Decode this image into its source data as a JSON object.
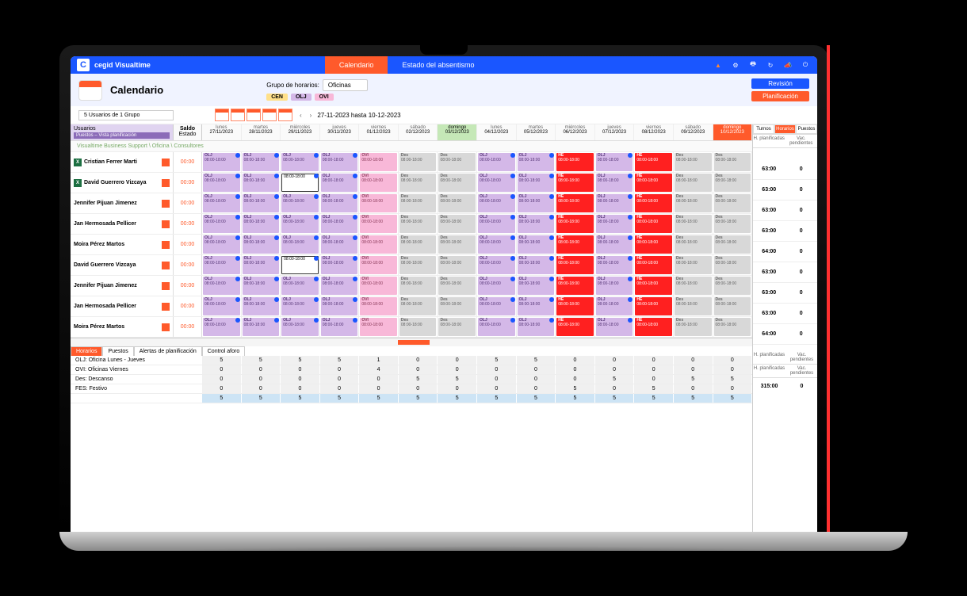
{
  "brand": "cegid Visualtime",
  "nav": {
    "calendario": "Calendario",
    "estado": "Estado del absentismo"
  },
  "page": {
    "title": "Calendario",
    "group_label": "Grupo de horarios:",
    "group_value": "Oficinas"
  },
  "pills": [
    {
      "label": "CEN",
      "bg": "#ffe08a"
    },
    {
      "label": "OLJ",
      "bg": "#d4b8e8"
    },
    {
      "label": "OVI",
      "bg": "#f8b8d8"
    }
  ],
  "buttons": {
    "revision": "Revisión",
    "planificacion": "Planificación"
  },
  "search": "5 Usuarios de 1 Grupo",
  "date_range": "27-11-2023 hasta 10-12-2023",
  "hdr": {
    "usuarios": "Usuarios",
    "usuarios_sub": "Puestos – Vista planificación",
    "saldo": "Saldo",
    "estado": "Estado"
  },
  "days": [
    {
      "dow": "lunes",
      "date": "27/11/2023"
    },
    {
      "dow": "martes",
      "date": "28/11/2023"
    },
    {
      "dow": "miércoles",
      "date": "29/11/2023"
    },
    {
      "dow": "jueves",
      "date": "30/11/2023"
    },
    {
      "dow": "viernes",
      "date": "01/12/2023"
    },
    {
      "dow": "sábado",
      "date": "02/12/2023"
    },
    {
      "dow": "domingo",
      "date": "03/12/2023",
      "active": true
    },
    {
      "dow": "lunes",
      "date": "04/12/2023"
    },
    {
      "dow": "martes",
      "date": "05/12/2023"
    },
    {
      "dow": "miércoles",
      "date": "06/12/2023"
    },
    {
      "dow": "jueves",
      "date": "07/12/2023"
    },
    {
      "dow": "viernes",
      "date": "08/12/2023"
    },
    {
      "dow": "sábado",
      "date": "09/12/2023"
    },
    {
      "dow": "domingo",
      "date": "10/12/2023",
      "last": true
    }
  ],
  "breadcrumb": "Visualtime Business Support \\ Oficina \\ Consultores",
  "employees": [
    {
      "name": "Cristian Ferrer Marti",
      "saldo": "00:00",
      "h": "63:00",
      "v": "0",
      "excel": true
    },
    {
      "name": "David Guerrero Vizcaya",
      "saldo": "00:00",
      "h": "63:00",
      "v": "0",
      "excel": true,
      "white29": true
    },
    {
      "name": "Jennifer Pijuan Jimenez",
      "saldo": "00:00",
      "h": "63:00",
      "v": "0"
    },
    {
      "name": "Jan Hermosada Pellicer",
      "saldo": "00:00",
      "h": "63:00",
      "v": "0"
    },
    {
      "name": "Moira Pérez Martos",
      "saldo": "00:00",
      "h": "64:00",
      "v": "0",
      "marker": true
    },
    {
      "name": "David Guerrero Vizcaya",
      "saldo": "00:00",
      "h": "63:00",
      "v": "0",
      "white29": true
    },
    {
      "name": "Jennifer Pijuan Jimenez",
      "saldo": "00:00",
      "h": "63:00",
      "v": "0"
    },
    {
      "name": "Jan Hermosada Pellicer",
      "saldo": "00:00",
      "h": "63:00",
      "v": "0"
    },
    {
      "name": "Moira Pérez Martos",
      "saldo": "00:00",
      "h": "64:00",
      "v": "0",
      "marker": true
    }
  ],
  "shift_labels": {
    "olj": "OLJ",
    "ovi": "OVI",
    "des": "Des",
    "fes": "FES",
    "h": "HE"
  },
  "shift_times": "08:00-18:00",
  "side": {
    "tabs": [
      "Turnos",
      "Horarios",
      "Puestos"
    ],
    "cols": [
      "H. planificadas",
      "Vac. pendientes"
    ]
  },
  "bottom": {
    "tabs": [
      "Horarios",
      "Puestos",
      "Alertas de planificación",
      "Control aforo"
    ],
    "rows": [
      {
        "label": "OLJ: Oficina Lunes - Jueves",
        "vals": [
          "5",
          "5",
          "5",
          "5",
          "1",
          "0",
          "0",
          "5",
          "5",
          "0",
          "0",
          "0",
          "0",
          "0"
        ]
      },
      {
        "label": "OVI: Oficinas Viernes",
        "vals": [
          "0",
          "0",
          "0",
          "0",
          "4",
          "0",
          "0",
          "0",
          "0",
          "0",
          "0",
          "0",
          "0",
          "0"
        ]
      },
      {
        "label": "Des: Descanso",
        "vals": [
          "0",
          "0",
          "0",
          "0",
          "0",
          "5",
          "5",
          "0",
          "0",
          "0",
          "5",
          "0",
          "5",
          "5"
        ]
      },
      {
        "label": "FES: Festivo",
        "vals": [
          "0",
          "0",
          "0",
          "0",
          "0",
          "0",
          "0",
          "0",
          "0",
          "5",
          "0",
          "5",
          "0",
          "0"
        ]
      }
    ],
    "total": [
      "5",
      "5",
      "5",
      "5",
      "5",
      "5",
      "5",
      "5",
      "5",
      "5",
      "5",
      "5",
      "5",
      "5"
    ],
    "side_cols": [
      "H. planificadas",
      "Vac. pendientes"
    ],
    "side_cols2": [
      "H. planificadas",
      "Vac. pendientes"
    ],
    "side_total": [
      "315:00",
      "0"
    ]
  }
}
